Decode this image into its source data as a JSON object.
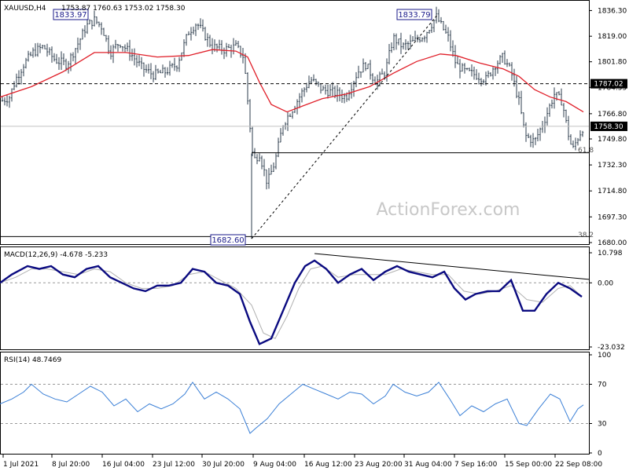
{
  "header": {
    "symbol": "XAUUSD,H4",
    "ohlc": "1753.87 1760.63 1753.02 1758.30",
    "macd_label": "MACD(12,26,9) -4.678 -5.233",
    "rsi_label": "RSI(14) 48.7469"
  },
  "watermark": "ActionForex.com",
  "annotations": {
    "high1": "1833.97",
    "high2": "1833.79",
    "low1": "1682.60",
    "fib618": "61.8",
    "fib382": "38.2"
  },
  "colors": {
    "bars": "#2e3e4e",
    "ma": "#e0202a",
    "macd": "#0a0a80",
    "signal": "#b0b0b0",
    "rsi": "#3a7fd6",
    "price_tag": "#000000",
    "label_box": "#1a1a8a"
  },
  "chart_data": [
    {
      "type": "candlestick",
      "title": "XAUUSD,H4",
      "ylim": [
        1680.0,
        1836.0
      ],
      "y_ticks": [
        "1836.30",
        "1819.00",
        "1801.80",
        "1784.55",
        "1766.80",
        "1749.80",
        "1732.30",
        "1714.80",
        "1697.30",
        "1680.00"
      ],
      "x_ticks": [
        "1 Jul 2021",
        "8 Jul 20:00",
        "16 Jul 04:00",
        "23 Jul 12:00",
        "30 Jul 20:00",
        "9 Aug 04:00",
        "16 Aug 12:00",
        "23 Aug 20:00",
        "31 Aug 04:00",
        "7 Sep 16:00",
        "15 Sep 00:00",
        "22 Sep 08:00"
      ],
      "current_price": "1758.30",
      "level_line": "1787.02",
      "level_value": 1787.02,
      "current_value": 1758.3,
      "fib_618_value": 1740.5,
      "fib_382_value": 1684.0,
      "trend_from": {
        "label": "1682.60",
        "value": 1682.6
      },
      "trend_to": {
        "label": "1833.79",
        "value": 1833.79
      },
      "close_path": [
        {
          "x": 0,
          "y": 1775
        },
        {
          "x": 12,
          "y": 1778
        },
        {
          "x": 20,
          "y": 1790
        },
        {
          "x": 30,
          "y": 1800
        },
        {
          "x": 42,
          "y": 1808
        },
        {
          "x": 55,
          "y": 1812
        },
        {
          "x": 70,
          "y": 1803
        },
        {
          "x": 85,
          "y": 1800
        },
        {
          "x": 100,
          "y": 1815
        },
        {
          "x": 110,
          "y": 1826
        },
        {
          "x": 120,
          "y": 1830
        },
        {
          "x": 130,
          "y": 1825
        },
        {
          "x": 140,
          "y": 1808
        },
        {
          "x": 152,
          "y": 1815
        },
        {
          "x": 165,
          "y": 1808
        },
        {
          "x": 180,
          "y": 1798
        },
        {
          "x": 195,
          "y": 1793
        },
        {
          "x": 210,
          "y": 1795
        },
        {
          "x": 225,
          "y": 1800
        },
        {
          "x": 240,
          "y": 1822
        },
        {
          "x": 250,
          "y": 1828
        },
        {
          "x": 260,
          "y": 1820
        },
        {
          "x": 270,
          "y": 1812
        },
        {
          "x": 285,
          "y": 1810
        },
        {
          "x": 300,
          "y": 1812
        },
        {
          "x": 310,
          "y": 1805
        },
        {
          "x": 318,
          "y": 1758
        },
        {
          "x": 322,
          "y": 1735
        },
        {
          "x": 330,
          "y": 1740
        },
        {
          "x": 340,
          "y": 1720
        },
        {
          "x": 350,
          "y": 1735
        },
        {
          "x": 360,
          "y": 1760
        },
        {
          "x": 372,
          "y": 1770
        },
        {
          "x": 385,
          "y": 1782
        },
        {
          "x": 395,
          "y": 1790
        },
        {
          "x": 410,
          "y": 1783
        },
        {
          "x": 425,
          "y": 1781
        },
        {
          "x": 440,
          "y": 1778
        },
        {
          "x": 455,
          "y": 1795
        },
        {
          "x": 465,
          "y": 1800
        },
        {
          "x": 478,
          "y": 1788
        },
        {
          "x": 490,
          "y": 1795
        },
        {
          "x": 500,
          "y": 1818
        },
        {
          "x": 512,
          "y": 1812
        },
        {
          "x": 525,
          "y": 1815
        },
        {
          "x": 540,
          "y": 1820
        },
        {
          "x": 555,
          "y": 1832
        },
        {
          "x": 570,
          "y": 1818
        },
        {
          "x": 580,
          "y": 1800
        },
        {
          "x": 592,
          "y": 1795
        },
        {
          "x": 605,
          "y": 1793
        },
        {
          "x": 618,
          "y": 1790
        },
        {
          "x": 630,
          "y": 1800
        },
        {
          "x": 640,
          "y": 1805
        },
        {
          "x": 650,
          "y": 1795
        },
        {
          "x": 660,
          "y": 1775
        },
        {
          "x": 668,
          "y": 1752
        },
        {
          "x": 680,
          "y": 1748
        },
        {
          "x": 692,
          "y": 1762
        },
        {
          "x": 705,
          "y": 1780
        },
        {
          "x": 715,
          "y": 1775
        },
        {
          "x": 722,
          "y": 1755
        },
        {
          "x": 728,
          "y": 1742
        },
        {
          "x": 736,
          "y": 1752
        },
        {
          "x": 742,
          "y": 1758
        }
      ],
      "ma_path": [
        {
          "x": 0,
          "y": 1778
        },
        {
          "x": 40,
          "y": 1785
        },
        {
          "x": 80,
          "y": 1795
        },
        {
          "x": 120,
          "y": 1808
        },
        {
          "x": 160,
          "y": 1808
        },
        {
          "x": 200,
          "y": 1805
        },
        {
          "x": 240,
          "y": 1806
        },
        {
          "x": 270,
          "y": 1810
        },
        {
          "x": 300,
          "y": 1809
        },
        {
          "x": 315,
          "y": 1805
        },
        {
          "x": 330,
          "y": 1788
        },
        {
          "x": 345,
          "y": 1773
        },
        {
          "x": 365,
          "y": 1768
        },
        {
          "x": 385,
          "y": 1772
        },
        {
          "x": 410,
          "y": 1777
        },
        {
          "x": 440,
          "y": 1780
        },
        {
          "x": 470,
          "y": 1785
        },
        {
          "x": 500,
          "y": 1794
        },
        {
          "x": 530,
          "y": 1802
        },
        {
          "x": 560,
          "y": 1807
        },
        {
          "x": 580,
          "y": 1806
        },
        {
          "x": 610,
          "y": 1801
        },
        {
          "x": 640,
          "y": 1797
        },
        {
          "x": 660,
          "y": 1792
        },
        {
          "x": 680,
          "y": 1783
        },
        {
          "x": 700,
          "y": 1778
        },
        {
          "x": 720,
          "y": 1775
        },
        {
          "x": 742,
          "y": 1768
        }
      ]
    },
    {
      "type": "line",
      "title": "MACD(12,26,9) -4.678 -5.233",
      "ylim": [
        -23.032,
        10.798
      ],
      "y_ticks": [
        "10.798",
        "0.00",
        "-23.032"
      ],
      "series": [
        {
          "name": "MACD",
          "values": [
            {
              "x": 0,
              "y": 0
            },
            {
              "x": 15,
              "y": 3
            },
            {
              "x": 35,
              "y": 6
            },
            {
              "x": 50,
              "y": 5
            },
            {
              "x": 65,
              "y": 6
            },
            {
              "x": 80,
              "y": 3
            },
            {
              "x": 95,
              "y": 2
            },
            {
              "x": 110,
              "y": 5
            },
            {
              "x": 125,
              "y": 6
            },
            {
              "x": 140,
              "y": 2
            },
            {
              "x": 155,
              "y": 0
            },
            {
              "x": 170,
              "y": -2
            },
            {
              "x": 185,
              "y": -3
            },
            {
              "x": 200,
              "y": -1
            },
            {
              "x": 215,
              "y": -1
            },
            {
              "x": 230,
              "y": 0
            },
            {
              "x": 245,
              "y": 5
            },
            {
              "x": 260,
              "y": 4
            },
            {
              "x": 275,
              "y": 0
            },
            {
              "x": 290,
              "y": -1
            },
            {
              "x": 305,
              "y": -4
            },
            {
              "x": 318,
              "y": -14
            },
            {
              "x": 330,
              "y": -22
            },
            {
              "x": 345,
              "y": -20
            },
            {
              "x": 360,
              "y": -10
            },
            {
              "x": 375,
              "y": 0
            },
            {
              "x": 388,
              "y": 6
            },
            {
              "x": 400,
              "y": 8
            },
            {
              "x": 415,
              "y": 5
            },
            {
              "x": 430,
              "y": 0
            },
            {
              "x": 445,
              "y": 3
            },
            {
              "x": 460,
              "y": 5
            },
            {
              "x": 475,
              "y": 1
            },
            {
              "x": 490,
              "y": 4
            },
            {
              "x": 505,
              "y": 6
            },
            {
              "x": 520,
              "y": 4
            },
            {
              "x": 535,
              "y": 3
            },
            {
              "x": 550,
              "y": 2
            },
            {
              "x": 565,
              "y": 4
            },
            {
              "x": 578,
              "y": -2
            },
            {
              "x": 592,
              "y": -6
            },
            {
              "x": 605,
              "y": -4
            },
            {
              "x": 620,
              "y": -3
            },
            {
              "x": 635,
              "y": -3
            },
            {
              "x": 650,
              "y": 1
            },
            {
              "x": 665,
              "y": -10
            },
            {
              "x": 680,
              "y": -10
            },
            {
              "x": 695,
              "y": -4
            },
            {
              "x": 710,
              "y": 0
            },
            {
              "x": 725,
              "y": -2
            },
            {
              "x": 740,
              "y": -5
            }
          ]
        },
        {
          "name": "Signal",
          "values": [
            {
              "x": 0,
              "y": 0
            },
            {
              "x": 20,
              "y": 2
            },
            {
              "x": 40,
              "y": 5
            },
            {
              "x": 60,
              "y": 5
            },
            {
              "x": 80,
              "y": 4
            },
            {
              "x": 100,
              "y": 3
            },
            {
              "x": 120,
              "y": 5
            },
            {
              "x": 140,
              "y": 4
            },
            {
              "x": 160,
              "y": 0
            },
            {
              "x": 180,
              "y": -2
            },
            {
              "x": 200,
              "y": -2
            },
            {
              "x": 220,
              "y": -1
            },
            {
              "x": 240,
              "y": 3
            },
            {
              "x": 260,
              "y": 4
            },
            {
              "x": 280,
              "y": 1
            },
            {
              "x": 300,
              "y": -2
            },
            {
              "x": 320,
              "y": -8
            },
            {
              "x": 335,
              "y": -18
            },
            {
              "x": 350,
              "y": -20
            },
            {
              "x": 365,
              "y": -12
            },
            {
              "x": 380,
              "y": -2
            },
            {
              "x": 395,
              "y": 5
            },
            {
              "x": 410,
              "y": 6
            },
            {
              "x": 430,
              "y": 2
            },
            {
              "x": 450,
              "y": 3
            },
            {
              "x": 470,
              "y": 3
            },
            {
              "x": 490,
              "y": 3
            },
            {
              "x": 510,
              "y": 5
            },
            {
              "x": 530,
              "y": 4
            },
            {
              "x": 550,
              "y": 3
            },
            {
              "x": 570,
              "y": 3
            },
            {
              "x": 590,
              "y": -3
            },
            {
              "x": 610,
              "y": -4
            },
            {
              "x": 630,
              "y": -3
            },
            {
              "x": 650,
              "y": -1
            },
            {
              "x": 670,
              "y": -6
            },
            {
              "x": 690,
              "y": -7
            },
            {
              "x": 710,
              "y": -2
            },
            {
              "x": 725,
              "y": -1
            },
            {
              "x": 740,
              "y": -5
            }
          ]
        }
      ]
    },
    {
      "type": "line",
      "title": "RSI(14) 48.7469",
      "ylim": [
        0,
        100
      ],
      "y_ticks": [
        "100",
        "70",
        "30",
        "0"
      ],
      "series": [
        {
          "name": "RSI(14)",
          "values": [
            {
              "x": 0,
              "y": 50
            },
            {
              "x": 15,
              "y": 55
            },
            {
              "x": 30,
              "y": 62
            },
            {
              "x": 40,
              "y": 70
            },
            {
              "x": 55,
              "y": 60
            },
            {
              "x": 70,
              "y": 55
            },
            {
              "x": 85,
              "y": 52
            },
            {
              "x": 100,
              "y": 60
            },
            {
              "x": 115,
              "y": 68
            },
            {
              "x": 130,
              "y": 62
            },
            {
              "x": 145,
              "y": 48
            },
            {
              "x": 160,
              "y": 55
            },
            {
              "x": 175,
              "y": 42
            },
            {
              "x": 190,
              "y": 50
            },
            {
              "x": 205,
              "y": 45
            },
            {
              "x": 220,
              "y": 50
            },
            {
              "x": 235,
              "y": 60
            },
            {
              "x": 245,
              "y": 72
            },
            {
              "x": 260,
              "y": 55
            },
            {
              "x": 275,
              "y": 62
            },
            {
              "x": 290,
              "y": 55
            },
            {
              "x": 305,
              "y": 45
            },
            {
              "x": 318,
              "y": 20
            },
            {
              "x": 325,
              "y": 25
            },
            {
              "x": 340,
              "y": 35
            },
            {
              "x": 355,
              "y": 50
            },
            {
              "x": 370,
              "y": 60
            },
            {
              "x": 385,
              "y": 70
            },
            {
              "x": 400,
              "y": 65
            },
            {
              "x": 415,
              "y": 60
            },
            {
              "x": 430,
              "y": 55
            },
            {
              "x": 445,
              "y": 62
            },
            {
              "x": 460,
              "y": 60
            },
            {
              "x": 475,
              "y": 50
            },
            {
              "x": 490,
              "y": 58
            },
            {
              "x": 500,
              "y": 70
            },
            {
              "x": 515,
              "y": 62
            },
            {
              "x": 530,
              "y": 58
            },
            {
              "x": 545,
              "y": 62
            },
            {
              "x": 558,
              "y": 72
            },
            {
              "x": 572,
              "y": 55
            },
            {
              "x": 585,
              "y": 38
            },
            {
              "x": 600,
              "y": 48
            },
            {
              "x": 615,
              "y": 42
            },
            {
              "x": 630,
              "y": 50
            },
            {
              "x": 645,
              "y": 55
            },
            {
              "x": 660,
              "y": 30
            },
            {
              "x": 670,
              "y": 28
            },
            {
              "x": 685,
              "y": 45
            },
            {
              "x": 700,
              "y": 60
            },
            {
              "x": 712,
              "y": 55
            },
            {
              "x": 725,
              "y": 32
            },
            {
              "x": 735,
              "y": 45
            },
            {
              "x": 742,
              "y": 49
            }
          ]
        }
      ]
    }
  ]
}
